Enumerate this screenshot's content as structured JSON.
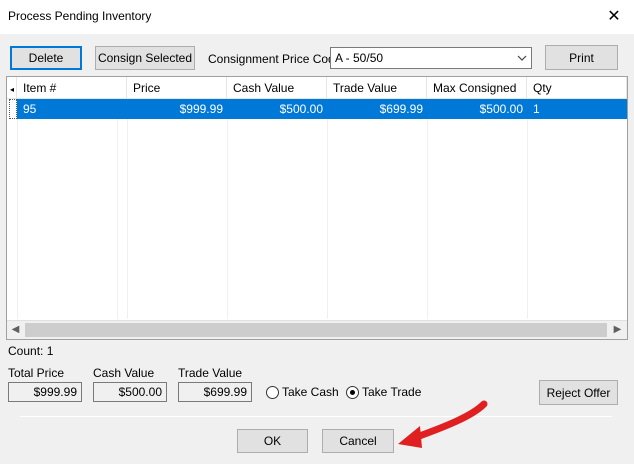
{
  "window": {
    "title": "Process Pending Inventory"
  },
  "toolbar": {
    "delete_label": "Delete",
    "consign_selected_label": "Consign Selected",
    "consignment_price_code_label": "Consignment Price Code",
    "price_code_value": "A - 50/50",
    "print_label": "Print"
  },
  "grid": {
    "columns": [
      "Item #",
      "Price",
      "Cash Value",
      "Trade Value",
      "Max Consigned",
      "Qty"
    ],
    "rows": [
      {
        "item": "95",
        "price": "$999.99",
        "cash_value": "$500.00",
        "trade_value": "$699.99",
        "max_consigned": "$500.00",
        "qty": "1"
      }
    ]
  },
  "footer": {
    "count_label": "Count: 1",
    "total_price_label": "Total Price",
    "total_price_value": "$999.99",
    "cash_value_label": "Cash Value",
    "cash_value_value": "$500.00",
    "trade_value_label": "Trade Value",
    "trade_value_value": "$699.99",
    "take_cash_label": "Take Cash",
    "take_trade_label": "Take Trade",
    "selected_option": "Take Trade",
    "reject_offer_label": "Reject Offer",
    "ok_label": "OK",
    "cancel_label": "Cancel"
  },
  "icons": {
    "close": "close-icon",
    "dropdown": "chevron-down-icon",
    "scroll_left": "scroll-left-icon",
    "scroll_right": "scroll-right-icon"
  },
  "colors": {
    "selection": "#0078d7",
    "annotation_arrow": "#e02020"
  }
}
